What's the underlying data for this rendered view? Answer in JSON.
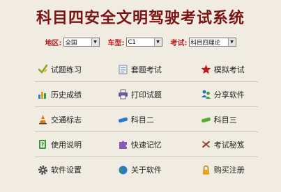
{
  "app": {
    "title": "科目四安全文明驾驶考试系统"
  },
  "filters": [
    {
      "label": "地区:",
      "value": "全国"
    },
    {
      "label": "车型:",
      "value": "C1"
    },
    {
      "label": "考试:",
      "value": "科目四理论"
    }
  ],
  "menu": [
    [
      {
        "label": "试题练习",
        "icon": "check-pencil-icon"
      },
      {
        "label": "套题考试",
        "icon": "document-icon"
      },
      {
        "label": "模拟考试",
        "icon": "star-icon"
      }
    ],
    [
      {
        "label": "历史成绩",
        "icon": "bar-chart-icon"
      },
      {
        "label": "打印试题",
        "icon": "printer-icon"
      },
      {
        "label": "分享软件",
        "icon": "users-icon"
      }
    ],
    [
      {
        "label": "交通标志",
        "icon": "traffic-cone-icon"
      },
      {
        "label": "科目二",
        "icon": "blue-car-icon"
      },
      {
        "label": "科目三",
        "icon": "green-car-icon"
      }
    ],
    [
      {
        "label": "使用说明",
        "icon": "help-book-icon"
      },
      {
        "label": "快速记忆",
        "icon": "puzzle-icon"
      },
      {
        "label": "考试秘笈",
        "icon": "tools-icon"
      }
    ],
    [
      {
        "label": "软件设置",
        "icon": "gear-icon"
      },
      {
        "label": "关于软件",
        "icon": "globe-icon"
      },
      {
        "label": "购买注册",
        "icon": "lock-icon"
      }
    ]
  ]
}
